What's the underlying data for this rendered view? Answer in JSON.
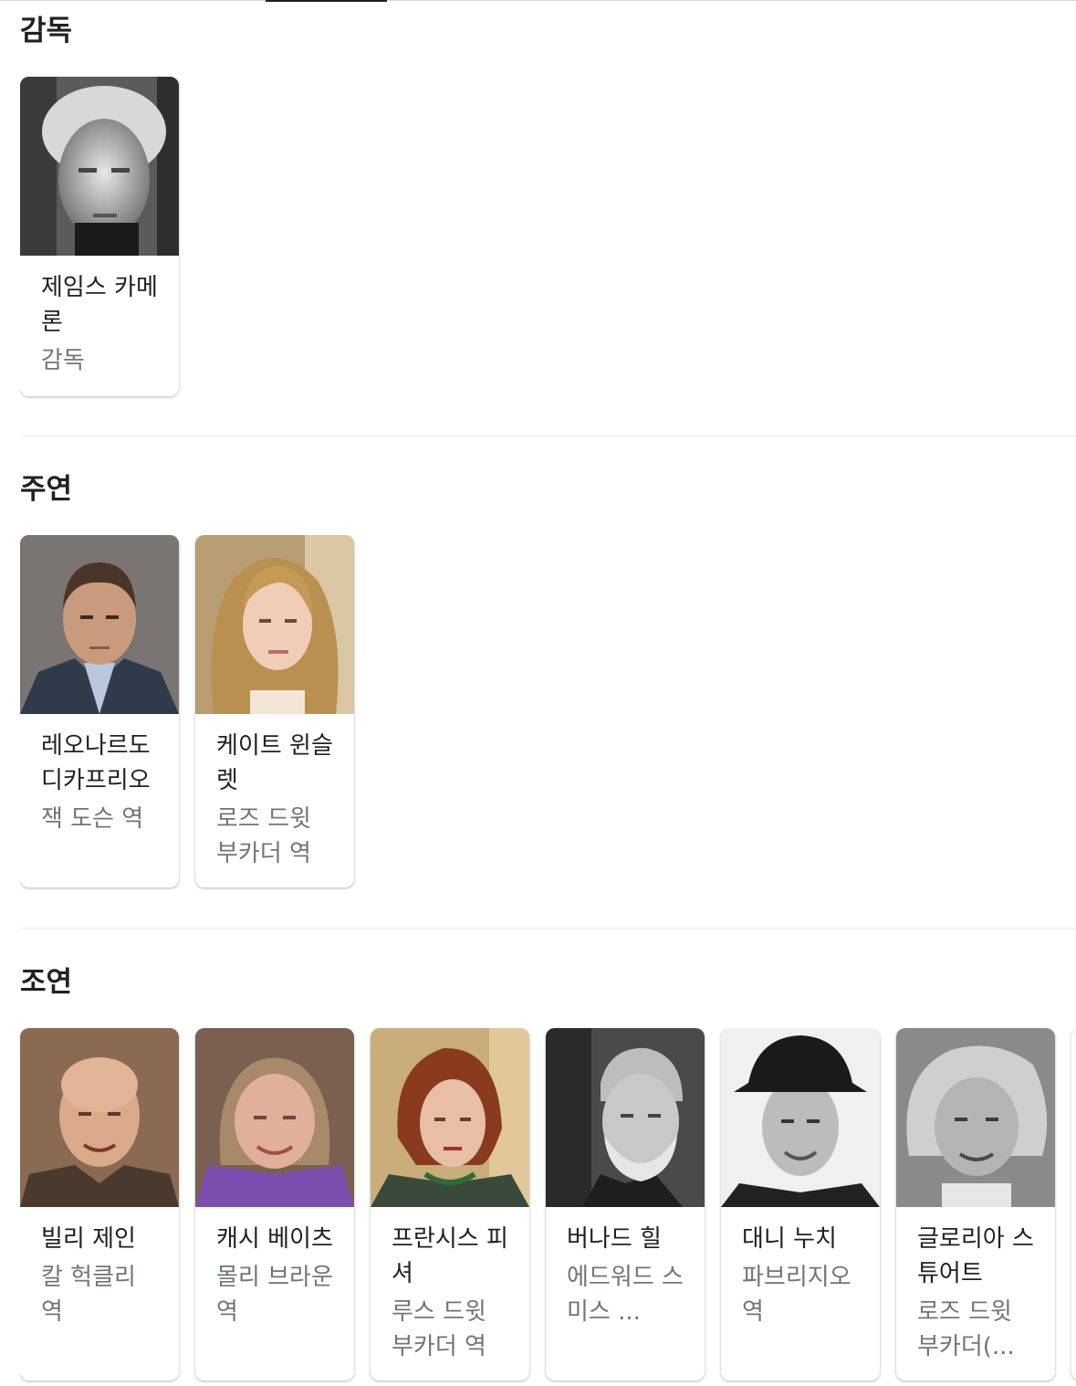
{
  "sections": {
    "director": {
      "title": "감독",
      "cards": [
        {
          "name": "제임스 카메론",
          "role": "감독"
        }
      ]
    },
    "lead": {
      "title": "주연",
      "cards": [
        {
          "name": "레오나르도 디카프리오",
          "role": "잭 도슨 역"
        },
        {
          "name": "케이트 윈슬렛",
          "role": "로즈 드윗 부카더 역"
        }
      ]
    },
    "supporting": {
      "title": "조연",
      "cards": [
        {
          "name": "빌리 제인",
          "role": "칼 헉클리 역"
        },
        {
          "name": "캐시 베이츠",
          "role": "몰리 브라운 역"
        },
        {
          "name": "프란시스 피셔",
          "role": "루스 드윗 부카더 역"
        },
        {
          "name": "버나드 힐",
          "role": "에드워드 스미스 ..."
        },
        {
          "name": "대니 누치",
          "role": "파브리지오 역"
        },
        {
          "name": "글로리아 스튜어트",
          "role": "로즈 드윗 부카더(..."
        }
      ]
    }
  }
}
